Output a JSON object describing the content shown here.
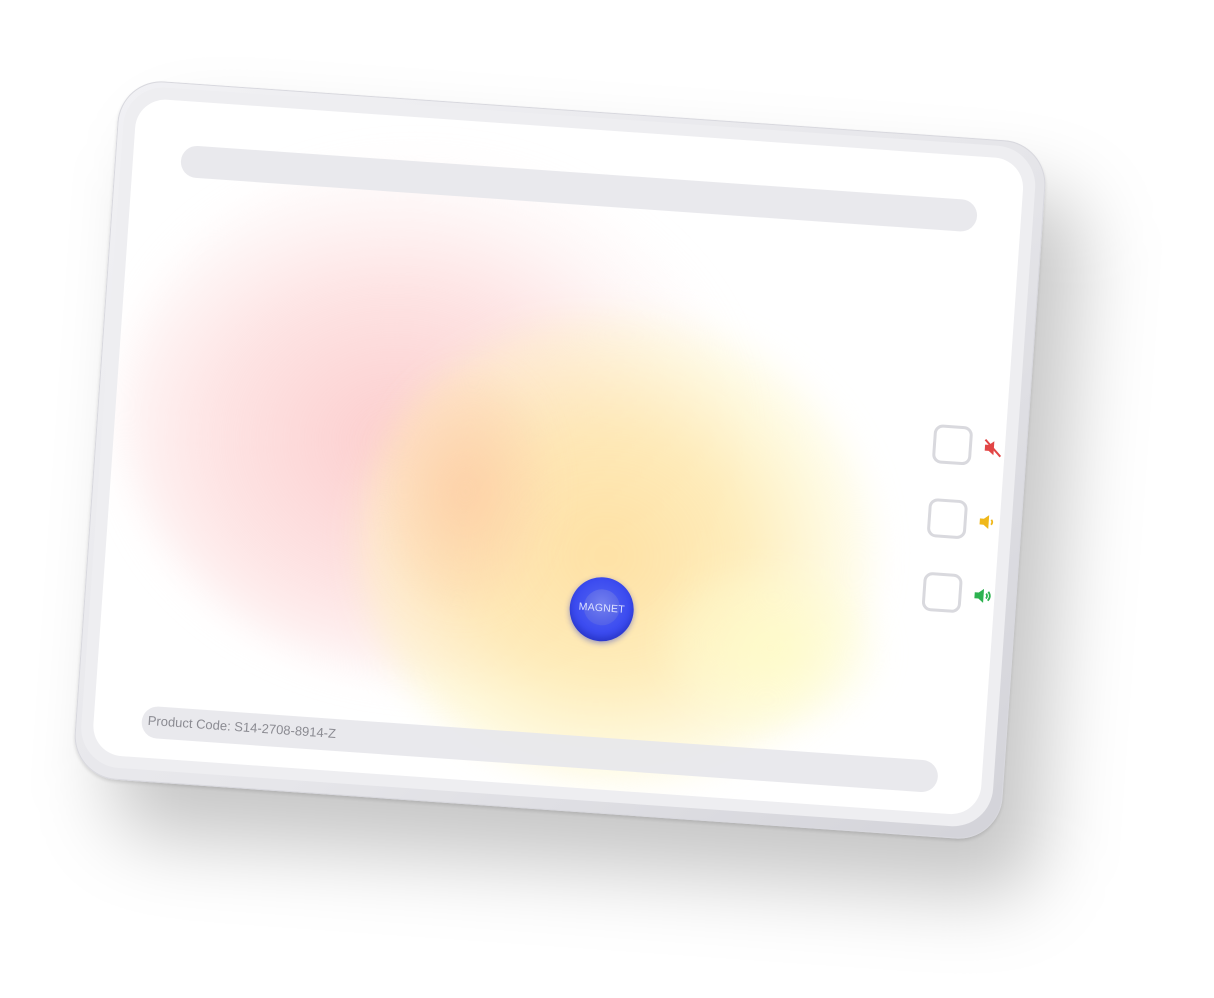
{
  "game": {
    "product_code": "Product Code: S14-2708-8914-Z",
    "magnet_label": "MAGNET"
  },
  "volume_slots": [
    {
      "level": "mute",
      "icon": "muted-speaker-icon",
      "color": "#e24545"
    },
    {
      "level": "low",
      "icon": "speaker-low-icon",
      "color": "#f0b81a"
    },
    {
      "level": "high",
      "icon": "speaker-high-icon",
      "color": "#2cb24f"
    }
  ],
  "colors": {
    "magnet": "#3c4cf0",
    "glow_pink": "#fcc4c4",
    "glow_yellow": "#fee0a0",
    "rail": "#e7e7ec"
  }
}
